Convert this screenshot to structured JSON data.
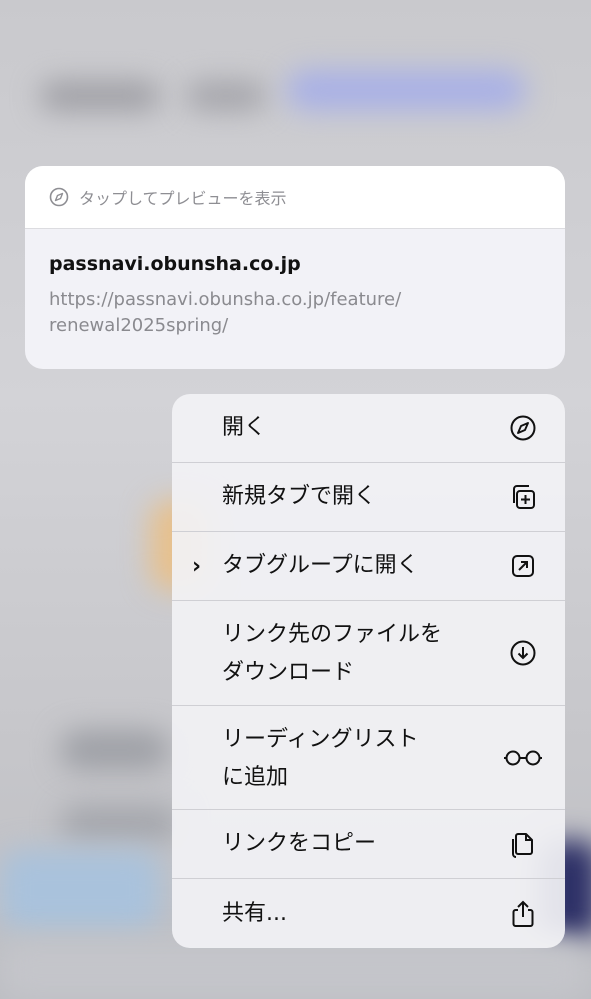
{
  "preview": {
    "hint": "タップしてプレビューを表示",
    "title": "passnavi.obunsha.co.jp",
    "url_line1": "https://passnavi.obunsha.co.jp/feature/",
    "url_line2": "renewal2025spring/"
  },
  "menu": {
    "open": "開く",
    "open_new_tab": "新規タブで開く",
    "open_in_tab_group": "タブグループに開く",
    "download_line1": "リンク先のファイルを",
    "download_line2": "ダウンロード",
    "reading_list_line1": "リーディングリスト",
    "reading_list_line2": "に追加",
    "copy_link": "リンクをコピー",
    "share": "共有..."
  },
  "icons": {
    "open": "compass-icon",
    "new_tab": "plus-square-icon",
    "tab_group": "arrow-up-right-square-icon",
    "download": "arrow-down-circle-icon",
    "reading_list": "glasses-icon",
    "copy": "doc-copy-icon",
    "share": "share-icon"
  }
}
